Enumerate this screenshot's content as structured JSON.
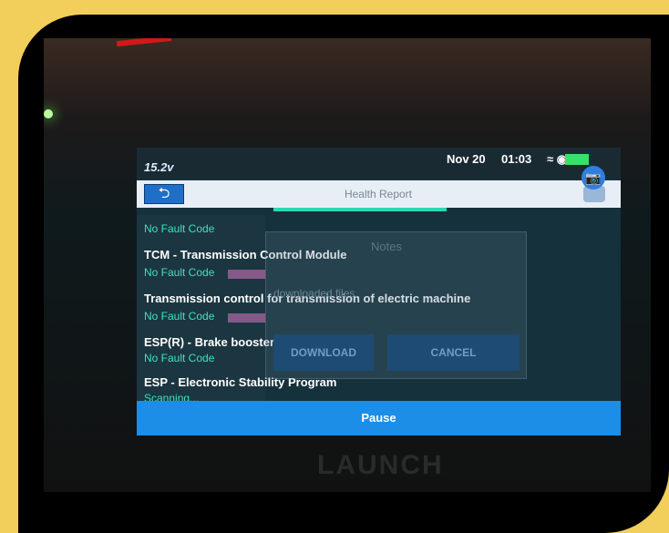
{
  "status_bar": {
    "voltage": "15.2v",
    "date": "Nov 20",
    "time": "01:03",
    "signal": "≈ ◉",
    "battery_color": "#39e06a"
  },
  "title_bar": {
    "back_icon": "⮌",
    "title": "Health Report",
    "share_icon": "share-icon"
  },
  "modules": [
    {
      "name": "",
      "status": "No Fault Code"
    },
    {
      "name": "TCM - Transmission Control Module",
      "status": "No Fault Code"
    },
    {
      "name": "Transmission control for transmission of electric machine",
      "status": "No Fault Code"
    },
    {
      "name": "ESP(R) - Brake booster",
      "status": "No Fault Code"
    },
    {
      "name": "ESP - Electronic Stability Program",
      "status": "Scanning..."
    }
  ],
  "dialog": {
    "title": "Notes",
    "message": "downloaded files.",
    "download_label": "DOWNLOAD",
    "cancel_label": "CANCEL"
  },
  "footer": {
    "pause_label": "Pause"
  },
  "device": {
    "brand": "LAUNCH"
  }
}
